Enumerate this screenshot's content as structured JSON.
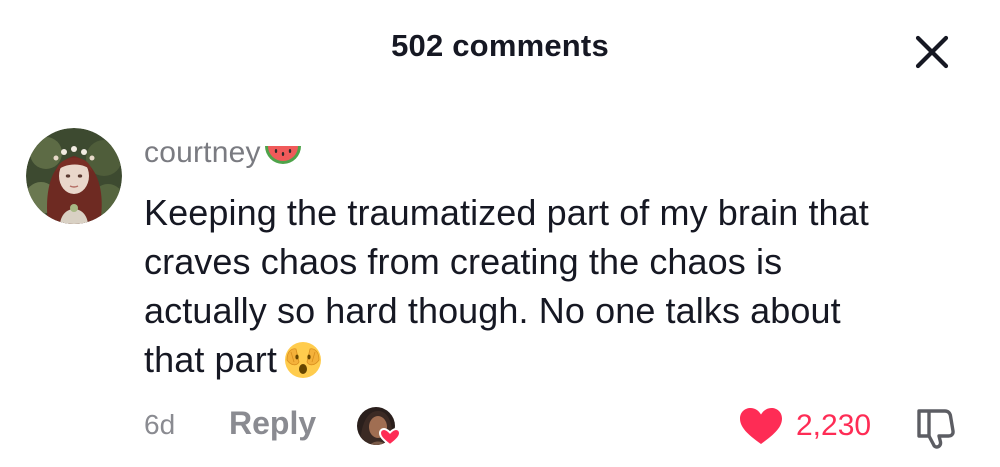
{
  "header": {
    "title": "502 comments",
    "close_icon": "close-icon"
  },
  "comment": {
    "username": "courtney",
    "username_emoji": "watermelon-icon",
    "text_lines": [
      "Keeping the traumatized part of my brain that",
      "craves chaos from creating the chaos is",
      "actually so hard though. No one talks about",
      "that part"
    ],
    "text_emoji": "face-with-hand-over-eyes-icon",
    "time": "6d",
    "reply_label": "Reply",
    "like_count": "2,230",
    "like_icon": "heart-icon",
    "dislike_icon": "thumbs-down-icon"
  },
  "colors": {
    "text_primary": "#161823",
    "text_secondary": "#8a8b91",
    "like": "#fe2c55"
  }
}
